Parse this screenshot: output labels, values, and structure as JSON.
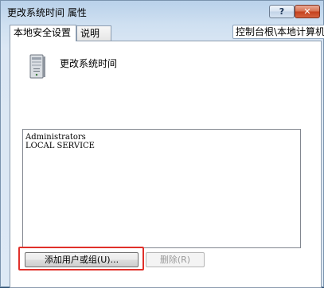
{
  "window": {
    "title": "更改系统时间 属性",
    "help_label": "?",
    "close_label": "✕"
  },
  "tabs": [
    {
      "label": "本地安全设置",
      "active": true
    },
    {
      "label": "说明",
      "active": false
    }
  ],
  "breadcrumb": "控制台根\\本地计算机 身",
  "policy": {
    "name": "更改系统时间",
    "icon": "computer-icon"
  },
  "accounts": [
    "Administrators",
    "LOCAL SERVICE"
  ],
  "buttons": {
    "add_label": "添加用户或组(U)...",
    "remove_label": "删除(R)"
  },
  "colors": {
    "highlight": "#e0302a",
    "close_button": "#c4401c"
  }
}
